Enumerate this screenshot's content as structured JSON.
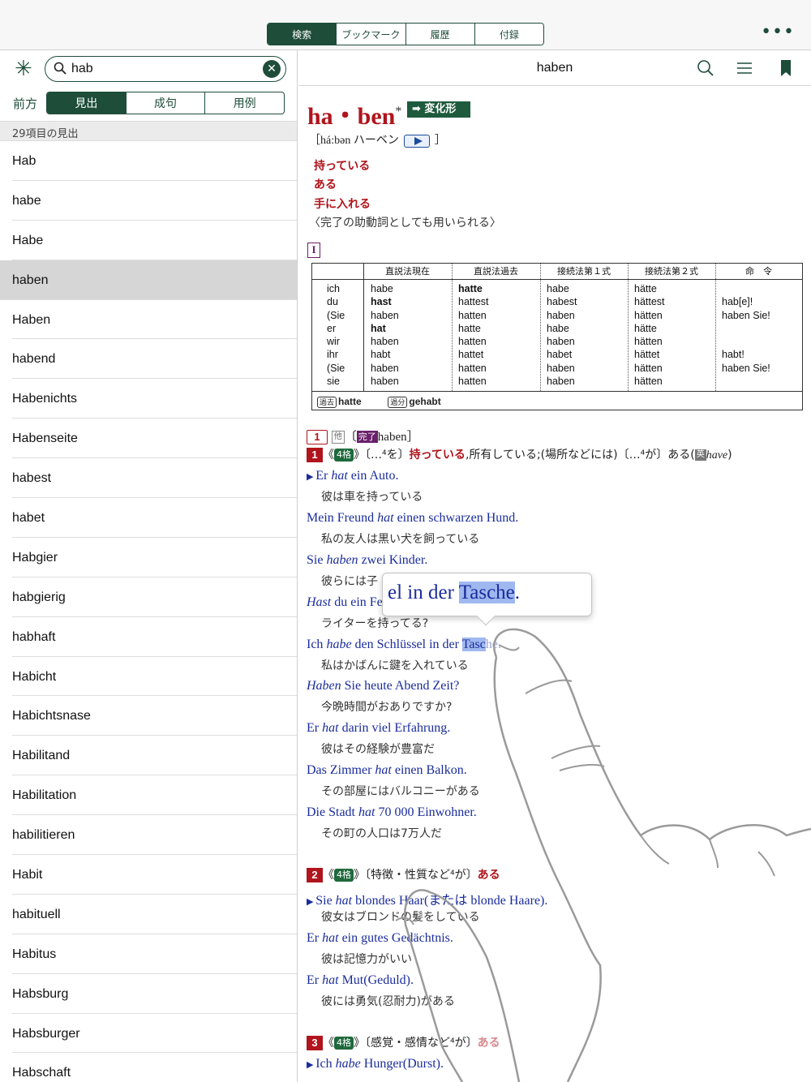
{
  "topbar": {
    "tabs": [
      "検索",
      "ブックマーク",
      "履歴",
      "付録"
    ],
    "active_tab": 0,
    "more_label": "•••"
  },
  "search": {
    "value": "hab",
    "asterisk": "✳"
  },
  "modes": {
    "label": "前方",
    "options": [
      "見出",
      "成句",
      "用例"
    ],
    "active": 0
  },
  "results": {
    "count_label": "29項目の見出",
    "items": [
      "Hab",
      "habe",
      "Habe",
      "haben",
      "Haben",
      "habend",
      "Habenichts",
      "Habenseite",
      "habest",
      "habet",
      "Habgier",
      "habgierig",
      "habhaft",
      "Habicht",
      "Habichtsnase",
      "Habilitand",
      "Habilitation",
      "habilitieren",
      "Habit",
      "habituell",
      "Habitus",
      "Habsburg",
      "Habsburger",
      "Habschaft"
    ],
    "selected": 3
  },
  "entry": {
    "header_title": "haben",
    "headword": "ha・ben",
    "asterisk": "*",
    "conj_label": "➡ 変化形",
    "pron_open": "［há:bən ハーベン",
    "pron_close": "］",
    "meanings": [
      "持っている",
      "ある",
      "手に入れる"
    ],
    "note": "〈完了の助動詞としても用いられる〉",
    "roman": "I",
    "table": {
      "headers": [
        "",
        "直説法現在",
        "直説法過去",
        "接続法第１式",
        "接続法第２式",
        "命　令"
      ],
      "pronouns": "ich\ndu\n(Sie\ner\nwir\nihr\n(Sie\nsie",
      "present": "habe\nhast\nhaben\nhat\nhaben\nhabt\nhaben\nhaben",
      "past": "hatte\nhattest\nhatten\nhatte\nhatten\nhattet\nhatten\nhatten",
      "konj1": "habe\nhabest\nhaben\nhabe\nhaben\nhabet\nhaben\nhaben",
      "konj2": "hätte\nhättest\nhätten\nhätte\nhätten\nhättet\nhätten\nhätten",
      "imperative": "\nhab[e]!\nhaben Sie!\n\n\nhabt!\nhaben Sie!\n",
      "past_tag": "過去",
      "past_form": "hatte",
      "pp_tag": "過分",
      "pp_form": "gehabt"
    },
    "sense1_head": {
      "num": "1",
      "tag1": "他",
      "tag2": "完了",
      "aux": "haben］"
    },
    "sense1": {
      "num": "1",
      "case": "4格",
      "text_a": "》〔…⁴を〕",
      "red": "持っている",
      "text_b": ",所有している;(場所などには)〔…⁴が〕ある(",
      "en_tag": "英",
      "en": "have",
      "close": ")"
    },
    "examples1": [
      {
        "de": "Er hat ein Auto.",
        "ja": "彼は車を持っている"
      },
      {
        "de": "Mein Freund hat einen schwarzen Hund.",
        "ja": "私の友人は黒い犬を飼っている"
      },
      {
        "de": "Sie haben zwei Kinder.",
        "ja": "彼らには子"
      },
      {
        "de": "Hast du ein Fe",
        "ja": "ライターを持ってる?"
      },
      {
        "de": "Ich habe den Schlüssel in der Tasche.",
        "ja": "私はかばんに鍵を入れている"
      },
      {
        "de": "Haben Sie heute Abend Zeit?",
        "ja": "今晩時間がおありですか?"
      },
      {
        "de": "Er hat darin viel Erfahrung.",
        "ja": "彼はその経験が豊富だ"
      },
      {
        "de": "Das Zimmer hat einen Balkon.",
        "ja": "その部屋にはバルコニーがある"
      },
      {
        "de": "Die Stadt hat 70 000 Einwohner.",
        "ja": "その町の人口は7万人だ"
      }
    ],
    "sense2": {
      "num": "2",
      "case": "4格",
      "text": "》〔特徴・性質など⁴が〕",
      "red": "ある"
    },
    "examples2": [
      {
        "de": "Sie hat blondes Haar(または blonde Haare).",
        "ja": "彼女はブロンドの髪をしている"
      },
      {
        "de": "Er hat ein gutes Gedächtnis.",
        "ja": "彼は記憶力がいい"
      },
      {
        "de": "Er hat Mut(Geduld).",
        "ja": "彼には勇気(忍耐力)がある"
      }
    ],
    "sense3": {
      "num": "3",
      "case": "4格",
      "text": "》〔感覚・感情など⁴が〕",
      "red": "ある"
    },
    "examples3": [
      {
        "de": "Ich habe Hunger(Durst).",
        "ja": ""
      }
    ]
  },
  "loupe": {
    "text_pre": "el in der ",
    "text_hl": "Tasche",
    "text_post": "."
  },
  "colors": {
    "accent": "#1e4d3a",
    "headword": "#b0141c",
    "example": "#1a2c9c",
    "highlight": "#9fb8ef"
  }
}
